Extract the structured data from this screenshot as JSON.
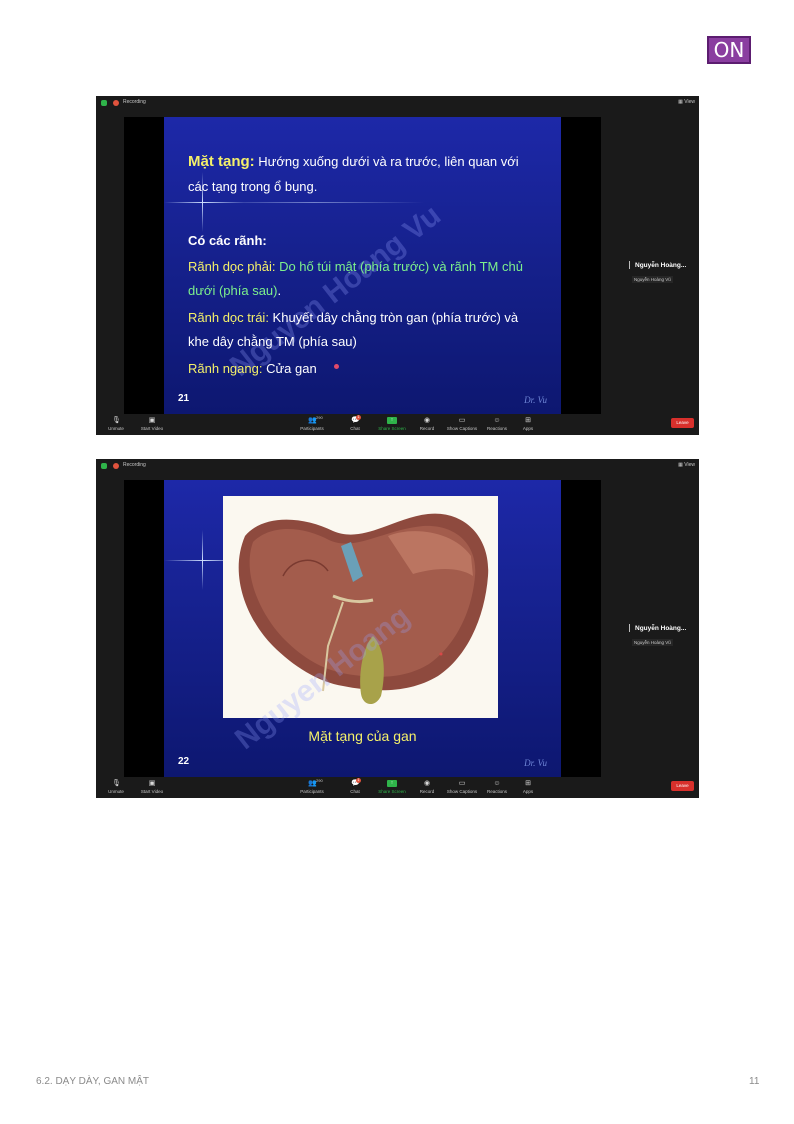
{
  "badge": {
    "label": "ON",
    "color": "#8a3ea0"
  },
  "footer": {
    "section": "6.2. DẠY DÀY, GAN MẬT",
    "page": "11"
  },
  "zoom": {
    "recording_label": "Recording",
    "view_label": "View",
    "participant_name": "Nguyễn Hoàng...",
    "participant_sub": "Nguyễn Hoàng Vũ",
    "toolbar": {
      "unmute": "Unmute",
      "start_video": "Start Video",
      "participants": "Participants",
      "participants_count": "290",
      "chat": "Chat",
      "chat_badge": "1",
      "share_screen": "Share Screen",
      "record": "Record",
      "show_captions": "Show Captions",
      "reactions": "Reactions",
      "apps": "Apps",
      "leave": "Leave"
    }
  },
  "slide21": {
    "number": "21",
    "signature": "Dr. Vu",
    "watermark": "Nguyen Hoang Vu",
    "line1_title": "Mặt tạng:",
    "line1_text": " Hướng xuống dưới và ra trước, liên quan với",
    "line2": "các tạng trong ổ bụng.",
    "heading": "Có các rãnh:",
    "r1_label": "Rãnh dọc phải:",
    "r1_text": " Do hố túi mật (phía trước) và rãnh TM chủ",
    "r1_text2": "dưới (phía sau)",
    "r1_end": ".",
    "r2_label": "Rãnh dọc trái:",
    "r2_text": " Khuyết dây chằng tròn gan (phía trước) và",
    "r2_text2": "khe dây chằng TM (phía sau)",
    "r3_label": "Rãnh ngang:",
    "r3_text": " Cửa gan"
  },
  "slide22": {
    "number": "22",
    "signature": "Dr. Vu",
    "watermark": "Nguyen Hoang",
    "caption": "Mặt tạng của gan",
    "image": "liver-visceral-surface-illustration"
  }
}
